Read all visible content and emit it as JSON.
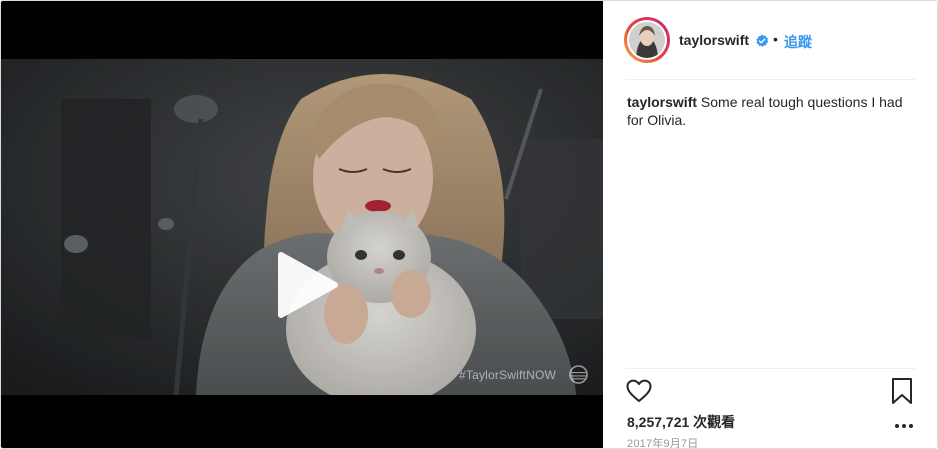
{
  "post": {
    "username": "taylorswift",
    "follow_label": "追蹤",
    "separator": "•",
    "caption_user": "taylorswift",
    "caption_text": "Some real tough questions I had for Olivia.",
    "views": "8,257,721 次觀看",
    "date": "2017年9月7日"
  },
  "video": {
    "watermark": "#TaylorSwiftNOW"
  },
  "icons": {
    "verified": "verified-badge-icon",
    "play": "play-icon",
    "like": "heart-icon",
    "save": "bookmark-icon",
    "more": "more-options-icon",
    "brand": "att-logo-icon"
  },
  "colors": {
    "accent": "#3897f0",
    "text": "#262626",
    "muted": "#999999",
    "divider": "#efefef"
  }
}
